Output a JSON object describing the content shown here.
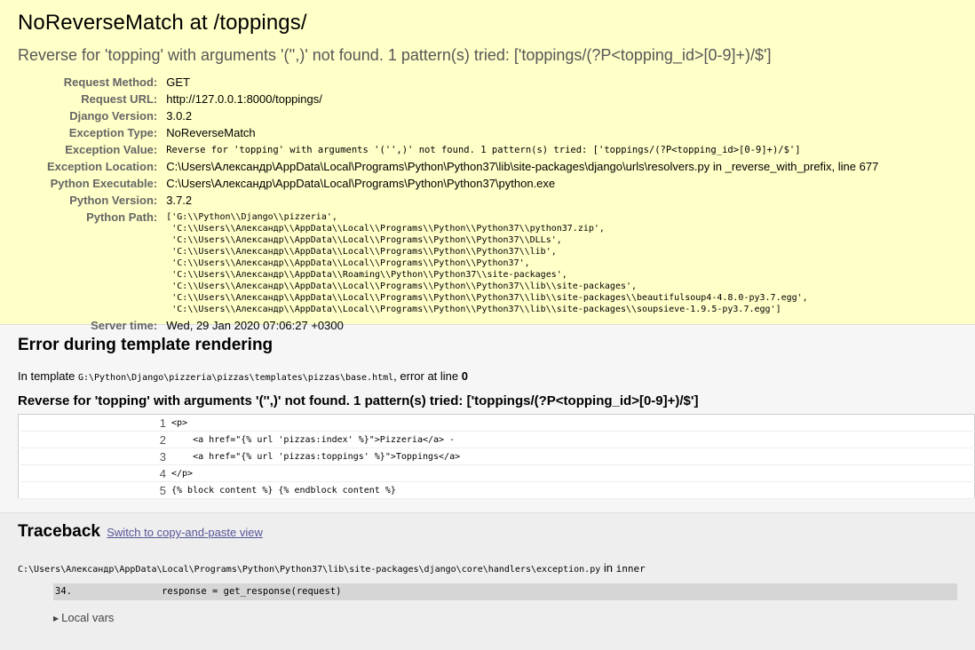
{
  "summary": {
    "title": "NoReverseMatch at /toppings/",
    "exception_text": "Reverse for 'topping' with arguments '('',)' not found. 1 pattern(s) tried: ['toppings/(?P<topping_id>[0-9]+)/$']",
    "rows": [
      {
        "label": "Request Method:",
        "value": "GET"
      },
      {
        "label": "Request URL:",
        "value": "http://127.0.0.1:8000/toppings/"
      },
      {
        "label": "Django Version:",
        "value": "3.0.2"
      },
      {
        "label": "Exception Type:",
        "value": "NoReverseMatch"
      },
      {
        "label": "Exception Value:",
        "value": "Reverse for 'topping' with arguments '('',)' not found. 1 pattern(s) tried: ['toppings/(?P<topping_id>[0-9]+)/$']"
      },
      {
        "label": "Exception Location:",
        "value": "C:\\Users\\Александр\\AppData\\Local\\Programs\\Python\\Python37\\lib\\site-packages\\django\\urls\\resolvers.py in _reverse_with_prefix, line 677"
      },
      {
        "label": "Python Executable:",
        "value": "C:\\Users\\Александр\\AppData\\Local\\Programs\\Python\\Python37\\python.exe"
      },
      {
        "label": "Python Version:",
        "value": "3.7.2"
      },
      {
        "label": "Python Path:",
        "value": ""
      },
      {
        "label": "Server time:",
        "value": "Wed, 29 Jan 2020 07:06:27 +0300"
      }
    ],
    "python_path": [
      "['G:\\\\Python\\\\Django\\\\pizzeria',",
      " 'C:\\\\Users\\\\Александр\\\\AppData\\\\Local\\\\Programs\\\\Python\\\\Python37\\\\python37.zip',",
      " 'C:\\\\Users\\\\Александр\\\\AppData\\\\Local\\\\Programs\\\\Python\\\\Python37\\\\DLLs',",
      " 'C:\\\\Users\\\\Александр\\\\AppData\\\\Local\\\\Programs\\\\Python\\\\Python37\\\\lib',",
      " 'C:\\\\Users\\\\Александр\\\\AppData\\\\Local\\\\Programs\\\\Python\\\\Python37',",
      " 'C:\\\\Users\\\\Александр\\\\AppData\\\\Roaming\\\\Python\\\\Python37\\\\site-packages',",
      " 'C:\\\\Users\\\\Александр\\\\AppData\\\\Local\\\\Programs\\\\Python\\\\Python37\\\\lib\\\\site-packages',",
      " 'C:\\\\Users\\\\Александр\\\\AppData\\\\Local\\\\Programs\\\\Python\\\\Python37\\\\lib\\\\site-packages\\\\beautifulsoup4-4.8.0-py3.7.egg',",
      " 'C:\\\\Users\\\\Александр\\\\AppData\\\\Local\\\\Programs\\\\Python\\\\Python37\\\\lib\\\\site-packages\\\\soupsieve-1.9.5-py3.7.egg']"
    ]
  },
  "template": {
    "heading": "Error during template rendering",
    "info_prefix": "In template ",
    "info_path": "G:\\Python\\Django\\pizzeria\\pizzas\\templates\\pizzas\\base.html",
    "info_mid": ", error at line ",
    "info_line": "0",
    "error_heading": "Reverse for 'topping' with arguments '('',)' not found. 1 pattern(s) tried: ['toppings/(?P<topping_id>[0-9]+)/$']",
    "source_lines": [
      {
        "num": "1",
        "code": "<p>"
      },
      {
        "num": "2",
        "code": "    <a href=\"{% url 'pizzas:index' %}\">Pizzeria</a> -"
      },
      {
        "num": "3",
        "code": "    <a href=\"{% url 'pizzas:toppings' %}\">Toppings</a>"
      },
      {
        "num": "4",
        "code": "</p>"
      },
      {
        "num": "5",
        "code": "{% block content %} {% endblock content %}"
      }
    ]
  },
  "traceback": {
    "heading": "Traceback",
    "switch_link": "Switch to copy-and-paste view",
    "frame_file": "C:\\Users\\Александр\\AppData\\Local\\Programs\\Python\\Python37\\lib\\site-packages\\django\\core\\handlers\\exception.py",
    "frame_in": " in ",
    "frame_func": "inner",
    "context_line_num": "34.",
    "context_line_code": "                response = get_response(request)",
    "local_vars": "Local vars"
  },
  "colors": {
    "summary_bg": "#ffffc8",
    "link": "#555599"
  }
}
